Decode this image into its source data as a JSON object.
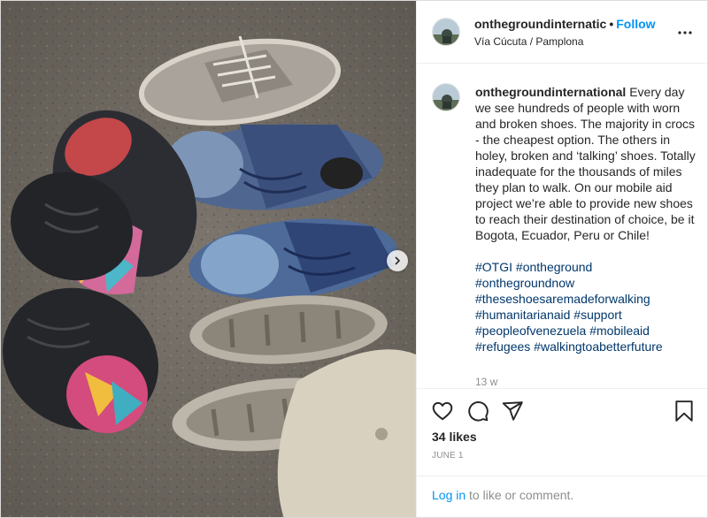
{
  "post": {
    "username": "ontheground​internatic",
    "follow_label": "Follow",
    "separator": "•",
    "location": "Vía Cúcuta / Pamplona"
  },
  "caption": {
    "username": "ontheground​international",
    "text": " Every day we see hundreds of people with worn and broken shoes. The majority in crocs - the cheapest option. The others in holey, broken and ‘talking’ shoes. Totally inadequate for the thousands of miles they plan to walk. On our mobile aid project we’re able to provide new shoes to reach their destination of choice, be it Bogota, Ecuador, Peru or Chile!",
    "hashtags": [
      "#OTGI",
      "#ontheground",
      "#ontheground​now",
      "#theseshoesaremadeforwalking",
      "#humanitarianaid",
      "#support",
      "#peopleofvenezuela",
      "#mobileaid",
      "#refugees",
      "#walkingtoabetterfuture"
    ],
    "relative_time": "13 w"
  },
  "engagement": {
    "likes": "34 likes",
    "date": "JUNE 1"
  },
  "comment": {
    "login_label": "Log in",
    "rest_label": " to like or comment."
  },
  "icons": {
    "more": "more-options-icon",
    "like": "heart-icon",
    "comment": "comment-icon",
    "share": "share-icon",
    "save": "bookmark-icon",
    "carousel": "chevron-right-icon"
  },
  "colors": {
    "accent": "#0095f6",
    "hashtag": "#00376b",
    "muted": "#8e8e8e"
  }
}
